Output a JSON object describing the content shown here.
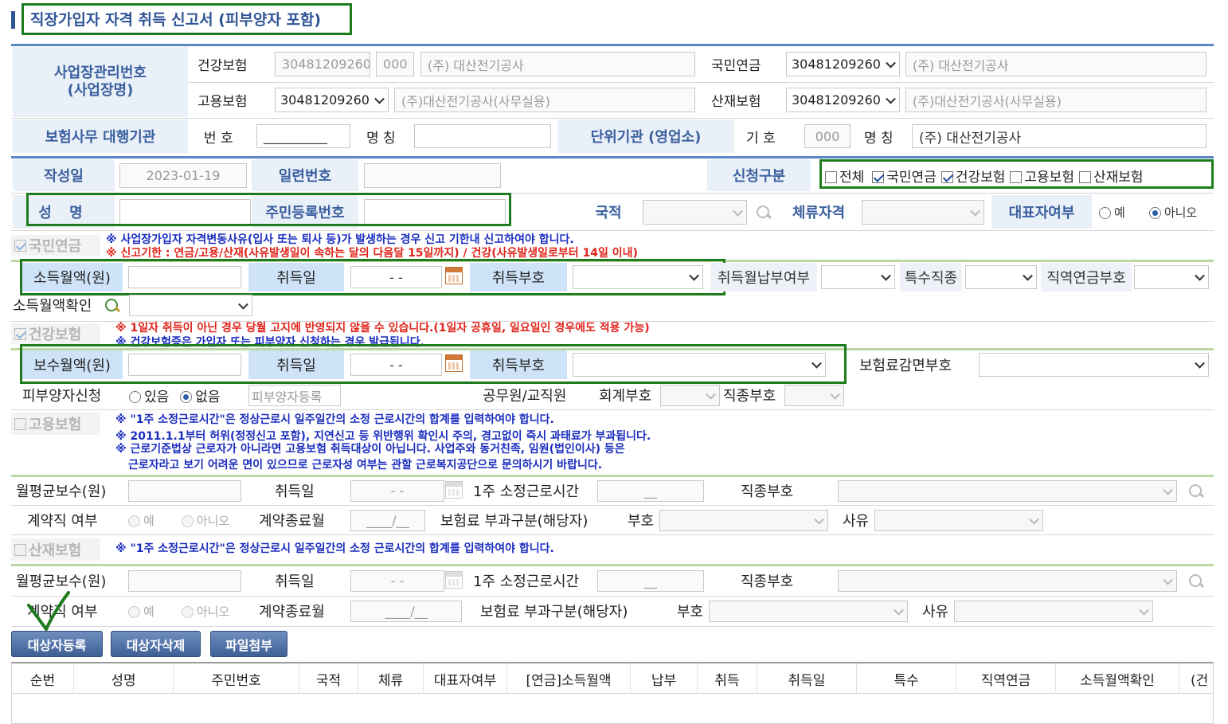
{
  "page": {
    "title": "직장가입자 자격 취득 신고서 (피부양자 포함)"
  },
  "workplace": {
    "label_line1": "사업장관리번호",
    "label_line2": "(사업장명)",
    "health": {
      "label": "건강보험",
      "number": "30481209260",
      "unit": "000",
      "name": "(주) 대산전기공사"
    },
    "pension": {
      "label": "국민연금",
      "number": "30481209260",
      "name": "(주) 대산전기공사"
    },
    "employment": {
      "label": "고용보험",
      "number": "30481209260",
      "name": "(주)대산전기공사(사무실용)"
    },
    "industrial": {
      "label": "산재보험",
      "number": "30481209260",
      "name": "(주)대산전기공사(사무실용)"
    }
  },
  "agency": {
    "label": "보험사무 대행기관",
    "number_label": "번 호",
    "number_value": "__________",
    "name_label": "명 칭",
    "unit_label": "단위기관 (영업소)",
    "code_label": "기 호",
    "code_value": "000",
    "unit_name_label": "명 칭",
    "unit_name_value": "(주) 대산전기공사"
  },
  "form": {
    "date_label": "작성일",
    "date_value": "2023-01-19",
    "serial_label": "일련번호",
    "apply_label": "신청구분",
    "apply_options": {
      "all": "전체",
      "pension": "국민연금",
      "health": "건강보험",
      "employment": "고용보험",
      "industrial": "산재보험"
    },
    "name_label": "성 명",
    "rrn_label": "주민등록번호",
    "nationality_label": "국적",
    "stay_label": "체류자격",
    "rep_label": "대표자여부",
    "rep_yes": "예",
    "rep_no": "아니오"
  },
  "pension": {
    "title": "국민연금",
    "note1": "※ 사업장가입자 자격변동사유(입사 또는 퇴사 등)가 발생하는 경우 신고 기한내 신고하여야 합니다.",
    "note2": "※ 신고기한 : 연금/고용/산재(사유발생일이 속하는 달의 다음달 15일까지) / 건강(사유발생일로부터 14일 이내)",
    "income_label": "소득월액(원)",
    "acq_date_label": "취득일",
    "acq_date_value": "- -",
    "acq_code_label": "취득부호",
    "pay_label": "취득월납부여부",
    "special_label": "특수직종",
    "occ_pension_label": "직역연금부호",
    "income_check_label": "소득월액확인"
  },
  "health": {
    "title": "건강보험",
    "note1": "※ 1일자 취득이 아닌 경우 당월 고지에 반영되지 않을 수 있습니다.(1일자 공휴일, 일요일인 경우에도 적용 가능)",
    "note2": "※ 건강보험증은 가입자 또는 피부양자 신청하는 경우 발급됩니다.",
    "wage_label": "보수월액(원)",
    "acq_date_label": "취득일",
    "acq_date_value": "- -",
    "acq_code_label": "취득부호",
    "reduction_label": "보험료감면부호",
    "dependent_label": "피부양자신청",
    "dep_yes": "있음",
    "dep_no": "없음",
    "dep_register": "피부양자등록",
    "civil_label": "공무원/교직원",
    "account_label": "회계부호",
    "occ_label": "직종부호"
  },
  "employment": {
    "title": "고용보험",
    "note1": "※ \"1주 소정근로시간\"은 정상근로시 일주일간의 소정 근로시간의 합계를 입력하여야 합니다.",
    "note2": "※ 2011.1.1부터 허위(정정신고 포함), 지연신고 등 위반행위 확인시 주의, 경고없이 즉시 과태료가 부과됩니다.",
    "note3": "※ 근로기준법상 근로자가 아니라면 고용보험 취득대상이 아닙니다. 사업주와 동거친족, 임원(법인이사) 등은",
    "note4": "근로자라고 보기 어려운 면이 있으므로 근로자성 여부는 관할 근로복지공단으로 문의하시기 바랍니다.",
    "avg_wage_label": "월평균보수(원)",
    "acq_date_label": "취득일",
    "acq_date_value": "- -",
    "hours_label": "1주 소정근로시간",
    "hours_value": "__",
    "occ_label": "직종부호",
    "contract_label": "계약직 여부",
    "yes": "예",
    "no": "아니오",
    "contract_end_label": "계약종료월",
    "contract_end_value": "____/__",
    "premium_label": "보험료 부과구분(해당자)",
    "code_label": "부호",
    "reason_label": "사유"
  },
  "industrial": {
    "title": "산재보험",
    "note1": "※ \"1주 소정근로시간\"은 정상근로시 일주일간의 소정 근로시간의 합계를 입력하여야 합니다.",
    "avg_wage_label": "월평균보수(원)",
    "acq_date_label": "취득일",
    "acq_date_value": "- -",
    "hours_label": "1주 소정근로시간",
    "hours_value": "__",
    "occ_label": "직종부호",
    "contract_label": "계약직 여부",
    "yes": "예",
    "no": "아니오",
    "contract_end_label": "계약종료월",
    "contract_end_value": "____/__",
    "premium_label": "보험료 부과구분(해당자)",
    "code_label": "부호",
    "reason_label": "사유"
  },
  "buttons": {
    "register": "대상자등록",
    "delete": "대상자삭제",
    "attach": "파일첨부"
  },
  "grid": {
    "columns": [
      "순번",
      "성명",
      "주민번호",
      "국적",
      "체류",
      "대표자여부",
      "[연금]소득월액",
      "납부",
      "취득",
      "취득일",
      "특수",
      "직역연금",
      "소득월액확인",
      "(건"
    ]
  },
  "colors": {
    "accent_blue": "#3a5f9e",
    "highlight_green": "#1e7b1e",
    "note_red": "#e0241a",
    "note_navy": "#1a2dbf"
  }
}
